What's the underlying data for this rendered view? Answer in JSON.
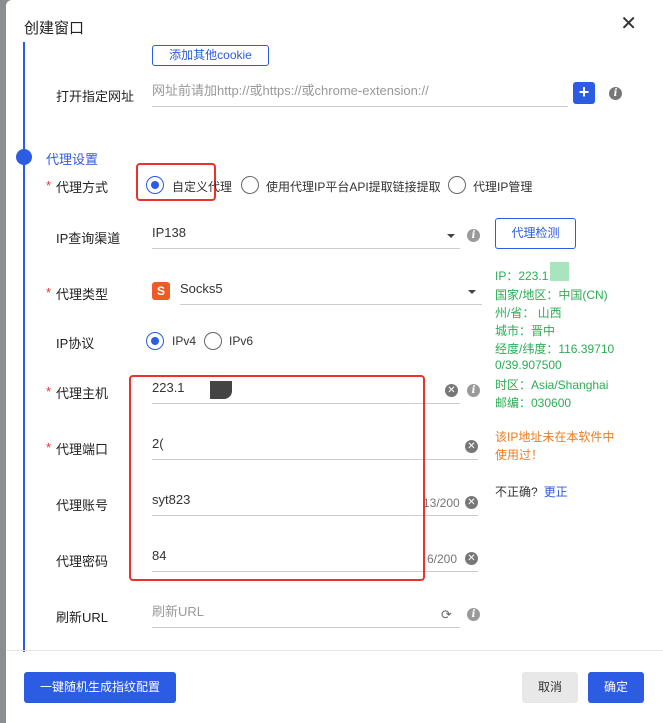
{
  "dialog": {
    "title": "创建窗口",
    "close": "✕"
  },
  "cookie": {
    "add_button": "添加其他cookie"
  },
  "url": {
    "label": "打开指定网址",
    "placeholder": "网址前请加http://或https://或chrome-extension://",
    "add": "+"
  },
  "proxy_section": "代理设置",
  "proxy_mode": {
    "label": "代理方式",
    "options": [
      "自定义代理",
      "使用代理IP平台API提取链接提取",
      "代理IP管理"
    ],
    "selected": "自定义代理"
  },
  "ip_channel": {
    "label": "IP查询渠道",
    "value": "IP138",
    "detect_button": "代理检测"
  },
  "proxy_type": {
    "label": "代理类型",
    "value": "Socks5",
    "icon_letter": "S"
  },
  "ip_protocol": {
    "label": "IP协议",
    "options": [
      "IPv4",
      "IPv6"
    ],
    "selected": "IPv4"
  },
  "proxy_host": {
    "label": "代理主机",
    "value": "223.1"
  },
  "proxy_port": {
    "label": "代理端口",
    "value": "2("
  },
  "proxy_user": {
    "label": "代理账号",
    "value": "syt823",
    "count": "13/200"
  },
  "proxy_pass": {
    "label": "代理密码",
    "value": "84",
    "count": "6/200"
  },
  "refresh_url": {
    "label": "刷新URL",
    "placeholder": "刷新URL"
  },
  "ip_info": {
    "ip": "IP：223.1",
    "country": "国家/地区：中国(CN)",
    "province": "州/省：  山西",
    "city": "城市：晋中",
    "coords_1": "经度/纬度：116.39710",
    "coords_2": "0/39.907500",
    "timezone": "时区：Asia/Shanghai",
    "postcode": "邮编：030600",
    "warning_1": "该IP地址未在本软件中",
    "warning_2": "使用过！",
    "incorrect": "不正确?",
    "correct_link": "更正"
  },
  "footer": {
    "random_button": "一键随机生成指纹配置",
    "cancel": "取消",
    "ok": "确定"
  },
  "colors": {
    "accent": "#2c5be4",
    "highlight": "#e8322b",
    "success": "#2bad54",
    "warning": "#f07c1e"
  }
}
